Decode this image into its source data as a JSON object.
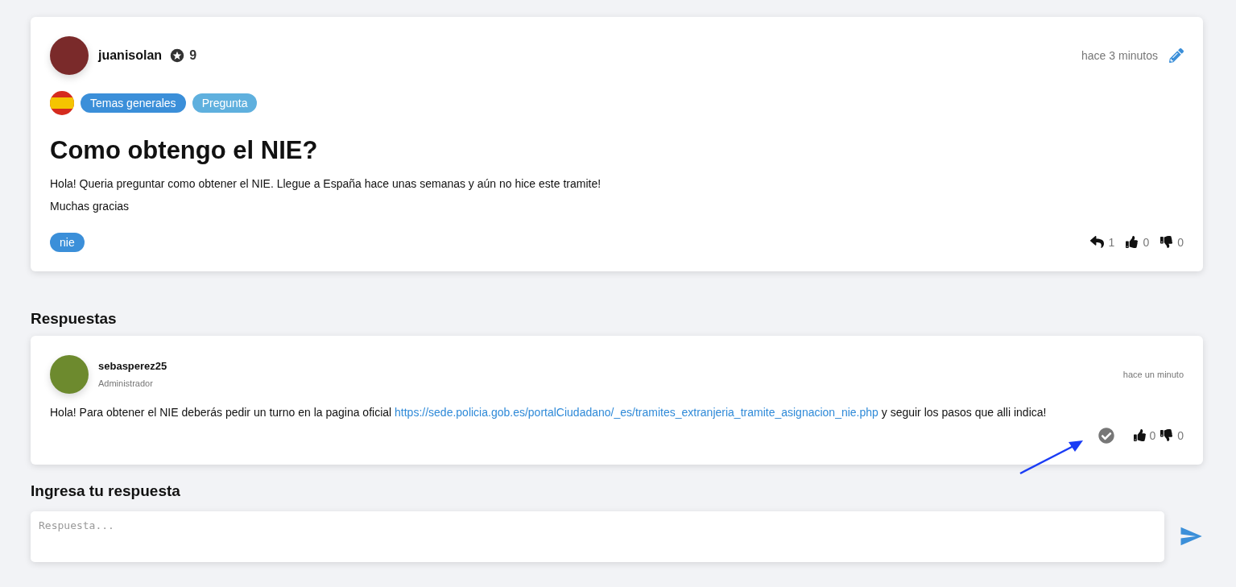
{
  "question": {
    "author": "juanisolan",
    "points": "9",
    "time": "hace 3 minutos",
    "tags": [
      {
        "label": "Temas generales",
        "color": "#3b8fd9"
      },
      {
        "label": "Pregunta",
        "color": "#5fb0de"
      }
    ],
    "title": "Como obtengo el NIE?",
    "body": [
      "Hola! Queria preguntar como obtener el NIE. Llegue a España hace unas semanas y aún no hice este tramite!",
      "Muchas gracias"
    ],
    "keywords": [
      "nie"
    ],
    "replies": "1",
    "likes": "0",
    "dislikes": "0"
  },
  "answers_heading": "Respuestas",
  "answers": [
    {
      "author": "sebasperez25",
      "role": "Administrador",
      "time": "hace un minuto",
      "body_before": "Hola! Para obtener el NIE deberás pedir un turno en la pagina oficial ",
      "link": "https://sede.policia.gob.es/portalCiudadano/_es/tramites_extranjeria_tramite_asignacion_nie.php",
      "body_after": " y seguir los pasos que alli indica!",
      "accepted": false,
      "likes": "0",
      "dislikes": "0"
    }
  ],
  "reply_heading": "Ingresa tu respuesta",
  "reply": {
    "placeholder": "Respuesta..."
  }
}
